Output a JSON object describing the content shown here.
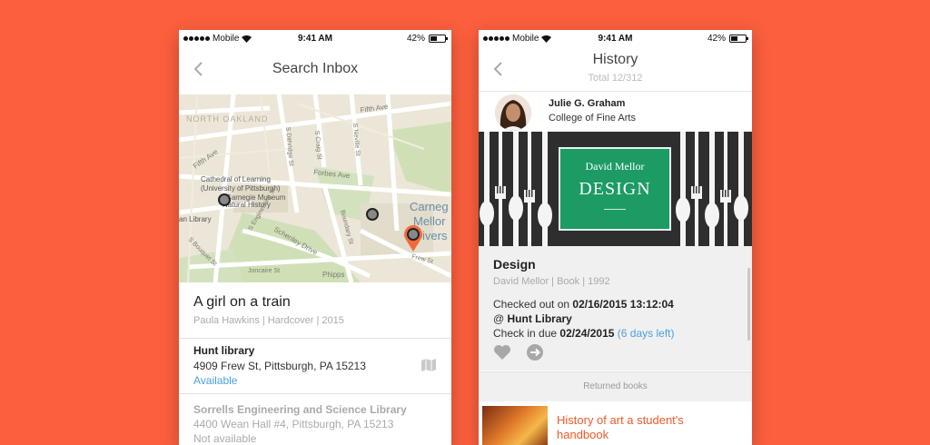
{
  "status_bar": {
    "carrier": "Mobile",
    "time": "9:41 AM",
    "battery": "42%"
  },
  "colors": {
    "background": "#fb5f3d",
    "accent_link": "#4a9fe0",
    "returned_title": "#f05a28",
    "cover_green": "#1c9b65"
  },
  "search_screen": {
    "title": "Search Inbox",
    "map": {
      "labels": {
        "north_oakland": "NORTH OAKLAND",
        "fifth_ave": "Fifth Ave",
        "fifth_ave_2": "Fifth Ave",
        "s_craig": "S Craig St",
        "s_dithridge": "S Dithridge St",
        "s_neville": "S Neville St",
        "forbes_ave": "Forbes Ave",
        "cathedral": "Cathedral of Learning",
        "univ_pitt": "(University of Pittsburgh)",
        "carnegie_museum": "Carnegie Museum",
        "natural_history": "Natural History",
        "library": "an Library",
        "boundary": "Boundary St",
        "schenley": "Schenley Drive",
        "bouquet": "S Bouquet St",
        "engineering": "S Engineering St",
        "joncaire": "Joncaire St",
        "phipps": "Phipps",
        "frew": "Frew St",
        "cmu1": "Carneg",
        "cmu2": "Mellor",
        "cmu3": "ivers"
      }
    },
    "book": {
      "title": "A girl on a train",
      "meta": "Paula Hawkins | Hardcover | 2015"
    },
    "libraries": [
      {
        "name": "Hunt library",
        "address": "4909 Frew St, Pittsburgh, PA 15213",
        "status": "Available"
      },
      {
        "name": "Sorrells Engineering and Science Library",
        "address": "4400 Wean Hall #4, Pittsburgh, PA 15213",
        "status": "Not available"
      }
    ],
    "map_icon": "map-icon"
  },
  "history_screen": {
    "title": "History",
    "subtitle": "Total 12/312",
    "user": {
      "name": "Julie G. Graham",
      "college": "College of Fine Arts"
    },
    "cover": {
      "author": "David Mellor",
      "word": "DESIGN"
    },
    "book": {
      "title": "Design",
      "meta": "David Mellor | Book | 1992",
      "checked_out_prefix": "Checked out on ",
      "checked_out_value": "02/16/2015 13:12:04",
      "at_prefix": "@ ",
      "at_value": "Hunt Library",
      "due_prefix": "Check in due ",
      "due_value": "02/24/2015",
      "days_left": "(6 days left)"
    },
    "actions": {
      "favorite": "heart-icon",
      "forward": "arrow-right-icon"
    },
    "returned_header": "Returned books",
    "returned": [
      {
        "title": "History of art a student's handbook"
      }
    ]
  }
}
